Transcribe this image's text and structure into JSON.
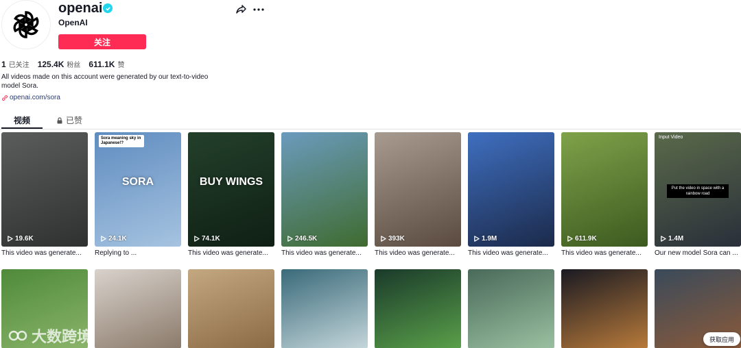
{
  "profile": {
    "username": "openai",
    "nickname": "OpenAI",
    "follow_label": "关注"
  },
  "stats": [
    {
      "num": "1",
      "label": "已关注"
    },
    {
      "num": "125.4K",
      "label": "粉丝"
    },
    {
      "num": "611.1K",
      "label": "赞"
    }
  ],
  "bio": "All videos made on this account were generated by our text-to-video model Sora.",
  "link": "openai.com/sora",
  "tabs": {
    "videos": "视频",
    "liked": "已赞"
  },
  "videos": [
    {
      "views": "19.6K",
      "caption": "This video was generate...",
      "colors": [
        "#5b5d5c",
        "#2f3130"
      ]
    },
    {
      "views": "24.1K",
      "caption": "Replying to ...",
      "colors": [
        "#5f8cc0",
        "#a6c3e0"
      ],
      "overlay_text": "SORA",
      "comment": "Sora meaning sky in Japanese!?"
    },
    {
      "views": "74.1K",
      "caption": "This video was generate...",
      "colors": [
        "#23402b",
        "#0f1f14"
      ],
      "overlay_text": "BUY WINGS"
    },
    {
      "views": "246.5K",
      "caption": "This video was generate...",
      "colors": [
        "#6b9bbd",
        "#3f6b2f"
      ]
    },
    {
      "views": "393K",
      "caption": "This video was generate...",
      "colors": [
        "#a89b8f",
        "#5a4a3f"
      ]
    },
    {
      "views": "1.9M",
      "caption": "This video was generate...",
      "colors": [
        "#3f6fc0",
        "#1b2a4a"
      ]
    },
    {
      "views": "611.9K",
      "caption": "This video was generate...",
      "colors": [
        "#7fa24a",
        "#3c5a1f"
      ]
    },
    {
      "views": "1.4M",
      "caption": "Our new model Sora can ...",
      "colors": [
        "#5a6a4a",
        "#2a2f3a"
      ],
      "top_label": "Input Video",
      "middle_text": "Put the video in space with a rainbow road"
    },
    {
      "views": "",
      "caption": "",
      "colors": [
        "#4f8a3a",
        "#8ab46a"
      ]
    },
    {
      "views": "",
      "caption": "",
      "colors": [
        "#d8d2cc",
        "#8b7a6a"
      ]
    },
    {
      "views": "",
      "caption": "",
      "colors": [
        "#c4a882",
        "#8a6a44"
      ]
    },
    {
      "views": "",
      "caption": "",
      "colors": [
        "#3a6a7a",
        "#c4d6da"
      ]
    },
    {
      "views": "",
      "caption": "",
      "colors": [
        "#1a3a2a",
        "#5aa04a"
      ]
    },
    {
      "views": "",
      "caption": "",
      "colors": [
        "#4a6a5a",
        "#9ac0a0"
      ]
    },
    {
      "views": "",
      "caption": "",
      "colors": [
        "#1a1a22",
        "#b87a3a"
      ]
    },
    {
      "views": "",
      "caption": "",
      "colors": [
        "#3a4a5a",
        "#8a5a3a"
      ]
    }
  ],
  "get_app_label": "获取应用",
  "watermark_text": "大数跨境"
}
